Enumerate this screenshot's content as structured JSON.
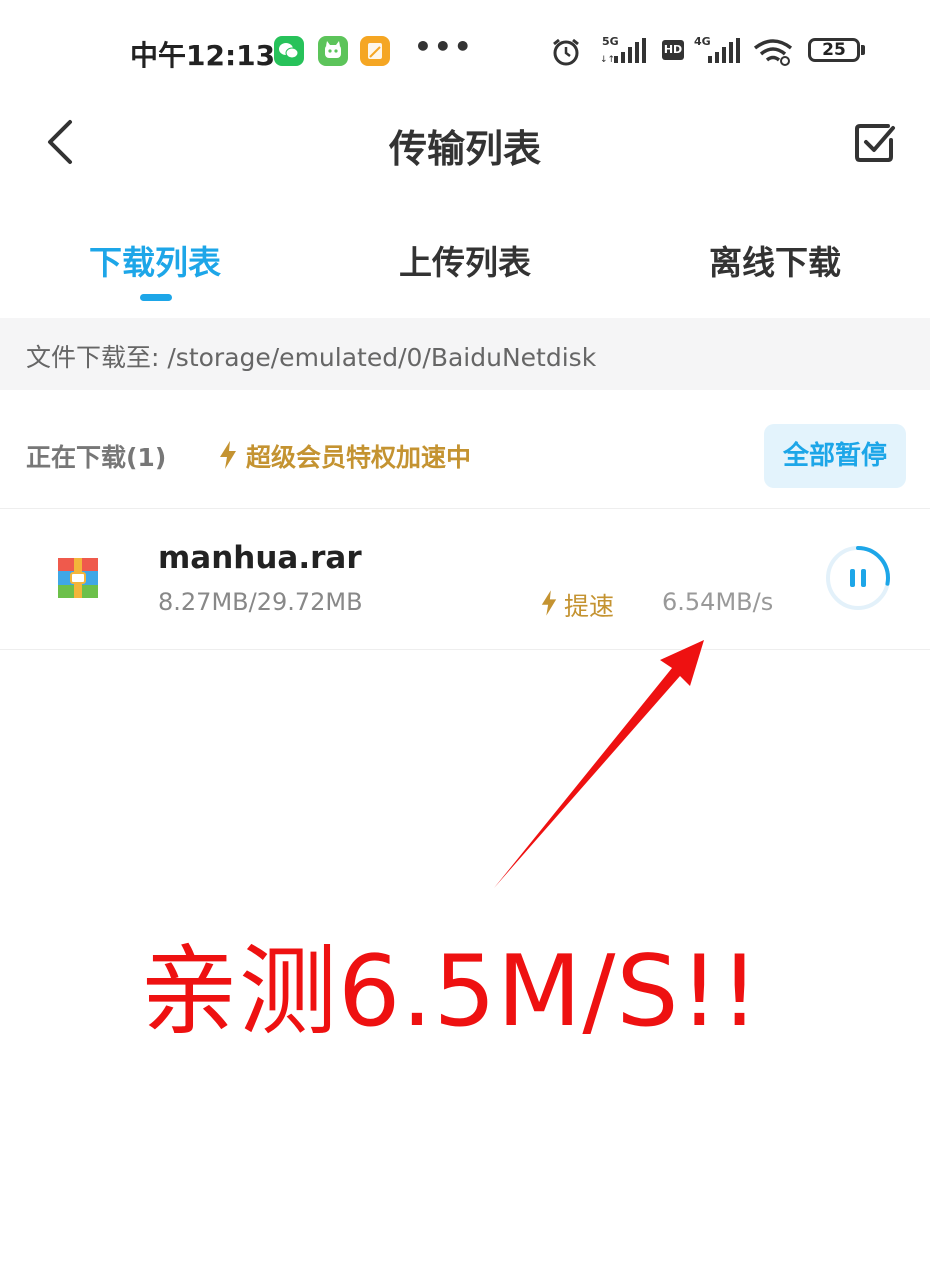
{
  "status_bar": {
    "time": "中午12:13",
    "app_icons": [
      "wechat-icon",
      "cat-app-icon",
      "notes-app-icon"
    ],
    "more": "•••",
    "network_1": "5G",
    "hd": "HD",
    "network_2": "4G",
    "battery": "25"
  },
  "header": {
    "title": "传输列表",
    "back_icon": "chevron-left-icon",
    "select_icon": "checkbox-icon"
  },
  "tabs": [
    {
      "label": "下载列表",
      "active": true
    },
    {
      "label": "上传列表",
      "active": false
    },
    {
      "label": "离线下载",
      "active": false
    }
  ],
  "download_path": "文件下载至: /storage/emulated/0/BaiduNetdisk",
  "section": {
    "title": "正在下载(1)",
    "vip_label": "超级会员特权加速中",
    "pause_all": "全部暂停"
  },
  "file": {
    "icon": "archive-file-icon",
    "name": "manhua.rar",
    "size": "8.27MB/29.72MB",
    "speedup_label": "提速",
    "speed": "6.54MB/s",
    "progress": 0.28
  },
  "annotation": {
    "text": "亲测6.5M/S!!",
    "color": "#ee1111"
  },
  "colors": {
    "accent": "#1da6e8",
    "gold": "#c49331"
  }
}
